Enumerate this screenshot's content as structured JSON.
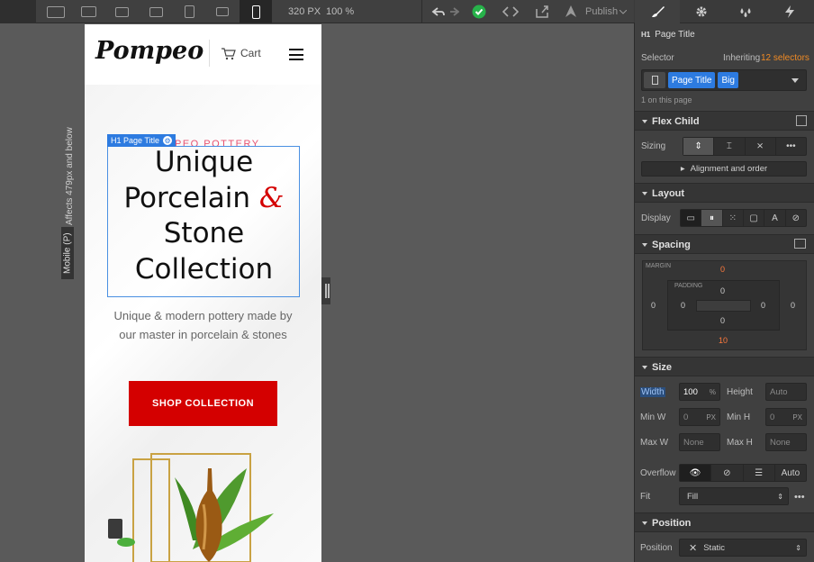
{
  "toolbar": {
    "width_readout": "320 PX",
    "zoom_readout": "100 %",
    "publish_label": "Publish",
    "breakpoints": [
      "desktop-large-icon",
      "desktop-icon",
      "laptop-icon",
      "desktop-star-icon",
      "tablet-icon",
      "mobile-landscape-icon",
      "mobile-portrait-icon"
    ]
  },
  "canvas": {
    "side_note": "Affects 479px and below",
    "breakpoint_tag": "Mobile (P)",
    "site": {
      "logo": "Pompeo",
      "cart_label": "Cart",
      "eyebrow": "PEO POTTERY",
      "heading_line1": "Unique",
      "heading_line2a": "Porcelain",
      "heading_amp": "&",
      "heading_line3": "Stone",
      "heading_line4": "Collection",
      "subtext_line1": "Unique & modern pottery made by",
      "subtext_line2": "our master in porcelain & stones",
      "cta_label": "SHOP COLLECTION"
    },
    "selection_tag": "H1 Page Title",
    "accent_color": "#d40000"
  },
  "panel": {
    "breadcrumb": "Page Title",
    "selector_label": "Selector",
    "inheriting_label": "Inheriting",
    "inheriting_count": "12 selectors",
    "selector_chips": [
      "Page Title",
      "Big"
    ],
    "on_page": "1 on this page",
    "flex_child": {
      "title": "Flex Child",
      "sizing_label": "Sizing",
      "alignment_label": "Alignment and order"
    },
    "layout": {
      "title": "Layout",
      "display_label": "Display"
    },
    "spacing": {
      "title": "Spacing",
      "margin_label": "MARGIN",
      "padding_label": "PADDING",
      "margin_top": "0",
      "margin_right": "0",
      "margin_bottom": "10",
      "margin_left": "0",
      "padding_top": "0",
      "padding_right": "0",
      "padding_bottom": "0",
      "padding_left": "0"
    },
    "size": {
      "title": "Size",
      "width_label": "Width",
      "width_value": "100",
      "width_unit": "%",
      "height_label": "Height",
      "height_value": "Auto",
      "minw_label": "Min W",
      "minw_value": "0",
      "minw_unit": "PX",
      "minh_label": "Min H",
      "minh_value": "0",
      "minh_unit": "PX",
      "maxw_label": "Max W",
      "maxw_value": "None",
      "maxh_label": "Max H",
      "maxh_value": "None",
      "overflow_label": "Overflow",
      "overflow_auto": "Auto",
      "fit_label": "Fit",
      "fit_value": "Fill"
    },
    "position": {
      "title": "Position",
      "position_label": "Position",
      "position_value": "Static"
    }
  }
}
